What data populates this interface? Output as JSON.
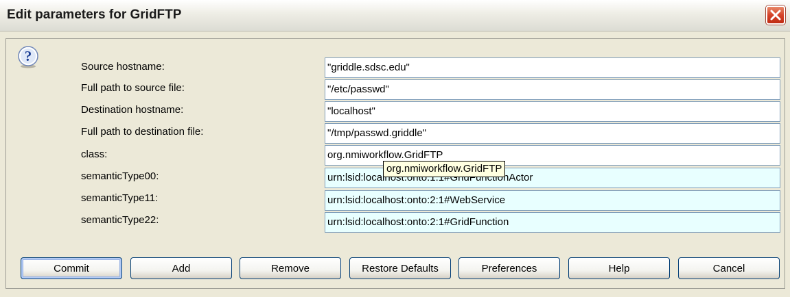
{
  "window": {
    "title": "Edit parameters for GridFTP",
    "close_icon": "close-icon"
  },
  "dialog": {
    "icon": "question-icon",
    "params": [
      {
        "label": "Source hostname:",
        "value": "\"griddle.sdsc.edu\""
      },
      {
        "label": "Full path to source file:",
        "value": "\"/etc/passwd\""
      },
      {
        "label": "Destination hostname:",
        "value": "\"localhost\""
      },
      {
        "label": "Full path to destination file:",
        "value": "\"/tmp/passwd.griddle\""
      },
      {
        "label": "class:",
        "value": "org.nmiworkflow.GridFTP"
      },
      {
        "label": "semanticType00:",
        "value": "urn:lsid:localhost:onto:1:1#GridFunctionActor"
      },
      {
        "label": "semanticType11:",
        "value": "urn:lsid:localhost:onto:2:1#WebService"
      },
      {
        "label": "semanticType22:",
        "value": "urn:lsid:localhost:onto:2:1#GridFunction"
      }
    ],
    "tooltip": "org.nmiworkflow.GridFTP"
  },
  "buttons": {
    "commit": "Commit",
    "add": "Add",
    "remove": "Remove",
    "restore_defaults": "Restore Defaults",
    "preferences": "Preferences",
    "help": "Help",
    "cancel": "Cancel"
  },
  "colors": {
    "semantic_field_bg": "#e8ffff",
    "tooltip_bg": "#ffffe1",
    "close_button": "#d5432a"
  }
}
